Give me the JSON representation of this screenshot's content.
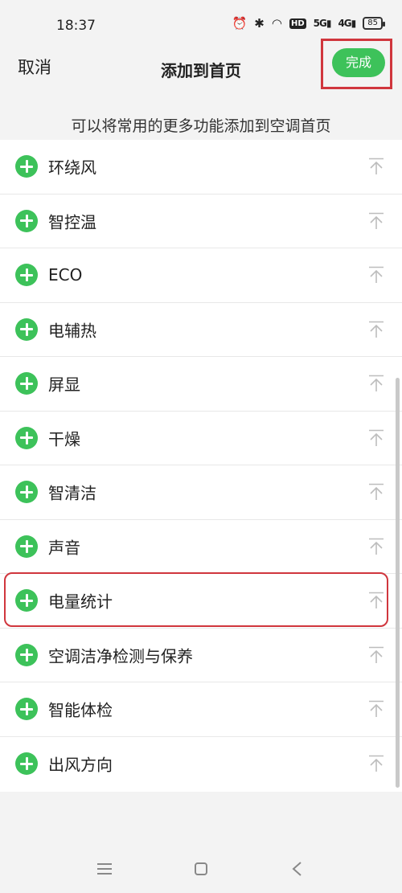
{
  "status": {
    "time": "18:37",
    "battery": "85",
    "net1": "5G",
    "net2": "4G",
    "hd": "HD"
  },
  "header": {
    "cancel_label": "取消",
    "title": "添加到首页",
    "done_label": "完成"
  },
  "hint": "可以将常用的更多功能添加到空调首页",
  "items": [
    {
      "label": "环绕风"
    },
    {
      "label": "智控温"
    },
    {
      "label": "ECO"
    },
    {
      "label": "电辅热"
    },
    {
      "label": "屏显"
    },
    {
      "label": "干燥"
    },
    {
      "label": "智清洁"
    },
    {
      "label": "声音"
    },
    {
      "label": "电量统计"
    },
    {
      "label": "空调洁净检测与保养"
    },
    {
      "label": "智能体检"
    },
    {
      "label": "出风方向"
    }
  ],
  "colors": {
    "accent": "#3dc25a",
    "highlight": "#d0363d",
    "header_bg": "#f3f3f3"
  },
  "icons": {
    "add": "plus-circle-icon",
    "pin": "pin-to-top-icon"
  }
}
